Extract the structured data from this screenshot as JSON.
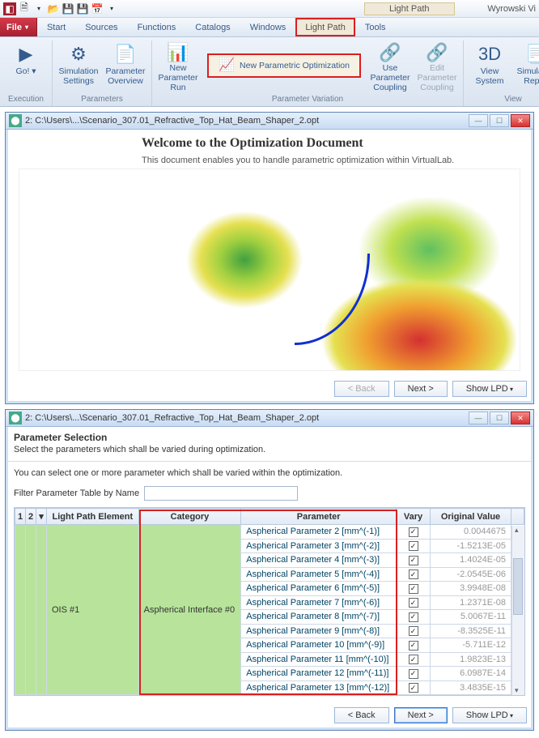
{
  "app": {
    "name": "Wyrowski Vi",
    "context_tab": "Light Path"
  },
  "qat_icons": [
    "app",
    "new",
    "open",
    "save",
    "saveall",
    "calendar",
    "dd"
  ],
  "menu": {
    "file": "File",
    "tabs": [
      "Start",
      "Sources",
      "Functions",
      "Catalogs",
      "Windows",
      "Light Path",
      "Tools"
    ],
    "active": "Light Path"
  },
  "ribbon": {
    "groups": [
      {
        "label": "Execution",
        "items": [
          {
            "name": "go",
            "label": "Go!",
            "icon": "▶",
            "dd": true
          }
        ]
      },
      {
        "label": "Parameters",
        "items": [
          {
            "name": "sim-settings",
            "label": "Simulation Settings",
            "icon": "⚙"
          },
          {
            "name": "param-overview",
            "label": "Parameter Overview",
            "icon": "📄"
          }
        ]
      },
      {
        "label": "Parameter Variation",
        "items": [
          {
            "name": "new-param-run",
            "label": "New Parameter Run",
            "icon": "📊"
          },
          {
            "name": "new-param-opt",
            "label": "New Parametric Optimization",
            "icon": "📈",
            "highlight": true
          },
          {
            "name": "use-coupling",
            "label": "Use Parameter Coupling",
            "icon": "🔗"
          },
          {
            "name": "edit-coupling",
            "label": "Edit Parameter Coupling",
            "icon": "🔗",
            "dim": true
          }
        ]
      },
      {
        "label": "View",
        "items": [
          {
            "name": "view-system",
            "label": "View System",
            "icon": "3D"
          },
          {
            "name": "sim-report",
            "label": "Simulation Report",
            "icon": "📑"
          }
        ]
      }
    ]
  },
  "window1": {
    "title": "2: C:\\Users\\...\\Scenario_307.01_Refractive_Top_Hat_Beam_Shaper_2.opt",
    "heading": "Welcome to the Optimization Document",
    "sub": "This document enables you to handle parametric optimization within VirtualLab.",
    "buttons": {
      "back": "< Back",
      "next": "Next >",
      "showlpd": "Show LPD"
    }
  },
  "window2": {
    "title": "2: C:\\Users\\...\\Scenario_307.01_Refractive_Top_Hat_Beam_Shaper_2.opt",
    "section": "Parameter Selection",
    "section_sub": "Select the parameters which shall be varied during optimization.",
    "instruction": "You can select one or more parameter which shall be varied within the optimization.",
    "filter_label": "Filter Parameter Table by Name",
    "filter_value": "",
    "columns": {
      "c1": "1",
      "c2": "2",
      "lpe": "Light Path Element",
      "cat": "Category",
      "param": "Parameter",
      "vary": "Vary",
      "orig": "Original Value"
    },
    "lpe_value": "OIS #1",
    "cat_value": "Aspherical Interface #0",
    "rows": [
      {
        "param": "Aspherical Parameter 2 [mm^(-1)]",
        "vary": true,
        "orig": "0.0044675"
      },
      {
        "param": "Aspherical Parameter 3 [mm^(-2)]",
        "vary": true,
        "orig": "-1.5213E-05"
      },
      {
        "param": "Aspherical Parameter 4 [mm^(-3)]",
        "vary": true,
        "orig": "1.4024E-05"
      },
      {
        "param": "Aspherical Parameter 5 [mm^(-4)]",
        "vary": true,
        "orig": "-2.0545E-06"
      },
      {
        "param": "Aspherical Parameter 6 [mm^(-5)]",
        "vary": true,
        "orig": "3.9948E-08"
      },
      {
        "param": "Aspherical Parameter 7 [mm^(-6)]",
        "vary": true,
        "orig": "1.2371E-08"
      },
      {
        "param": "Aspherical Parameter 8 [mm^(-7)]",
        "vary": true,
        "orig": "5.0067E-11"
      },
      {
        "param": "Aspherical Parameter 9 [mm^(-8)]",
        "vary": true,
        "orig": "-8.3525E-11"
      },
      {
        "param": "Aspherical Parameter 10 [mm^(-9)]",
        "vary": true,
        "orig": "-5.711E-12"
      },
      {
        "param": "Aspherical Parameter 11 [mm^(-10)]",
        "vary": true,
        "orig": "1.9823E-13"
      },
      {
        "param": "Aspherical Parameter 12 [mm^(-11)]",
        "vary": true,
        "orig": "6.0987E-14"
      },
      {
        "param": "Aspherical Parameter 13 [mm^(-12)]",
        "vary": true,
        "orig": "3.4835E-15"
      }
    ],
    "buttons": {
      "back": "< Back",
      "next": "Next >",
      "showlpd": "Show LPD"
    }
  }
}
